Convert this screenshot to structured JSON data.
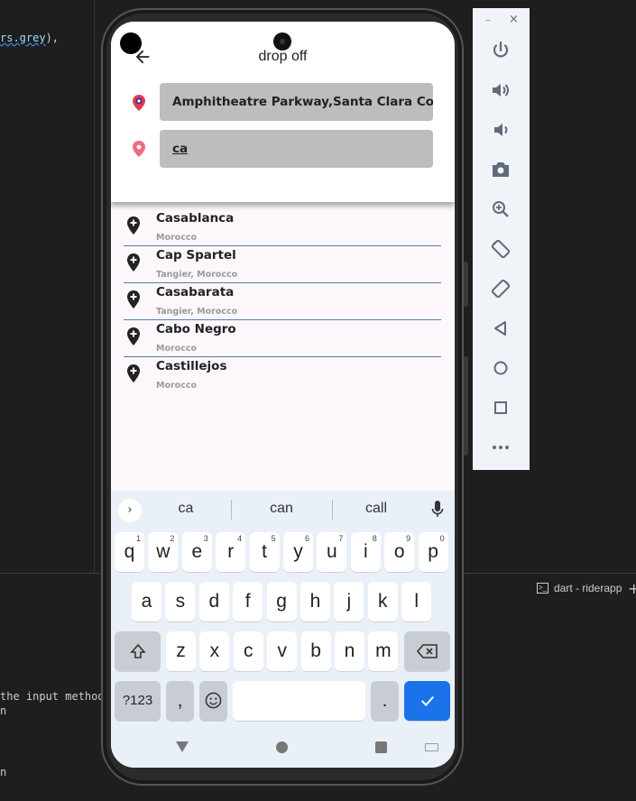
{
  "ide": {
    "code_snippet_a": "rs.grey",
    "code_snippet_b": "),",
    "terminal_tab_label": "dart - riderapp",
    "terminal_lines": [
      "the input method",
      "n",
      "n"
    ]
  },
  "app": {
    "title": "drop off",
    "pickup_value": "Amphitheatre Parkway,Santa Clara Co",
    "dropoff_value": "ca",
    "results": [
      {
        "title": "Casablanca",
        "subtitle": "Morocco"
      },
      {
        "title": "Cap Spartel",
        "subtitle": "Tangier, Morocco"
      },
      {
        "title": "Casabarata",
        "subtitle": "Tangier, Morocco"
      },
      {
        "title": "Cabo Negro",
        "subtitle": "Morocco"
      },
      {
        "title": "Castillejos",
        "subtitle": "Morocco"
      }
    ]
  },
  "keyboard": {
    "suggestions": [
      "ca",
      "can",
      "call"
    ],
    "row1": [
      "q",
      "w",
      "e",
      "r",
      "t",
      "y",
      "u",
      "i",
      "o",
      "p"
    ],
    "row1_nums": [
      "1",
      "2",
      "3",
      "4",
      "5",
      "6",
      "7",
      "8",
      "9",
      "0"
    ],
    "row2": [
      "a",
      "s",
      "d",
      "f",
      "g",
      "h",
      "j",
      "k",
      "l"
    ],
    "row3": [
      "z",
      "x",
      "c",
      "v",
      "b",
      "n",
      "m"
    ],
    "symbols_label": "?123",
    "comma": ",",
    "period": "."
  },
  "emulator_toolbar": {
    "minimize": "–",
    "close": "×",
    "buttons": [
      "power-icon",
      "volume-up-icon",
      "volume-down-icon",
      "camera-icon",
      "zoom-icon",
      "rotate-left-icon",
      "rotate-right-icon",
      "back-icon",
      "home-icon",
      "overview-icon",
      "more-icon"
    ]
  },
  "colors": {
    "accent_blue": "#1a73e8",
    "pin_red": "#e53950",
    "field_grey": "#bdbdbd",
    "separator": "#5a7fa8"
  }
}
